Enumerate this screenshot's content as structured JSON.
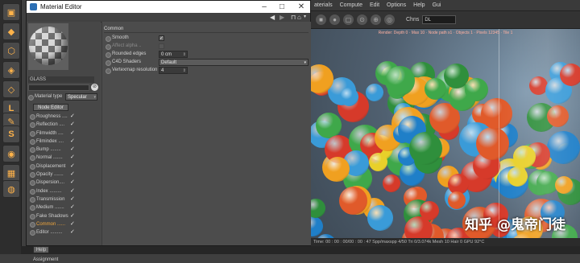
{
  "app": {
    "menubar": [
      "aterials",
      "Compute",
      "Edit",
      "Options",
      "Help",
      "Gui"
    ],
    "render_toolbar": {
      "channel_label": "Chns",
      "channel_value": "DL"
    },
    "render_info": "Render: Depth 0 · Max 10 · Node path x1 · Objects 1 · Pixels 12345 · Tile 1",
    "statusbar": "Time: 00 : 00 : 00/00 : 00 : 47    Spp/maxspp 4/50    Tri 0/3.074k    Mesh 10    Hair 0    GPU    92°C",
    "watermark": "知乎 @鬼帝门徒",
    "colors": {
      "accent": "#f0a63c",
      "window_title_bg": "#ffffff",
      "panel_bg": "#4a4a4a"
    }
  },
  "material_editor": {
    "title": "Material Editor",
    "window_buttons": {
      "minimize": "–",
      "maximize": "□",
      "close": "✕"
    },
    "material_name": "GLASS",
    "material_type_label": "Material type",
    "material_type_value": "Specular",
    "node_editor_label": "Node Editor",
    "channels": [
      {
        "label": "Roughness ....",
        "checked": true,
        "active": false
      },
      {
        "label": "Reflection ....",
        "checked": true,
        "active": false
      },
      {
        "label": "Filmwidth ....",
        "checked": true,
        "active": false
      },
      {
        "label": "Filmindex ....",
        "checked": true,
        "active": false
      },
      {
        "label": "Bump ........",
        "checked": true,
        "active": false
      },
      {
        "label": "Normal .......",
        "checked": true,
        "active": false
      },
      {
        "label": "Displacement",
        "checked": true,
        "active": false
      },
      {
        "label": "Opacity .......",
        "checked": true,
        "active": false
      },
      {
        "label": "Dispersion....",
        "checked": true,
        "active": false
      },
      {
        "label": "Index .........",
        "checked": true,
        "active": false
      },
      {
        "label": "Transmission",
        "checked": true,
        "active": false
      },
      {
        "label": "Medium .......",
        "checked": true,
        "active": false
      },
      {
        "label": "Fake Shadows",
        "checked": true,
        "active": false
      },
      {
        "label": "Common ......",
        "checked": true,
        "active": true
      },
      {
        "label": "Editor .........",
        "checked": true,
        "active": false
      }
    ],
    "help_label": "Help",
    "assignment_label": "Assignment",
    "section_title": "Common",
    "properties": {
      "smooth": {
        "label": "Smooth",
        "checked": true
      },
      "affect_alpha": {
        "label": "Affect alpha ..",
        "checked": false
      },
      "rounded_edges": {
        "label": "Rounded edges",
        "value": "0 cm"
      },
      "c4d_shaders": {
        "label": "C4D Shaders",
        "value": "Default"
      },
      "vertexmap_resolution": {
        "label": "Vertexmap resolution",
        "value": "4"
      }
    }
  }
}
